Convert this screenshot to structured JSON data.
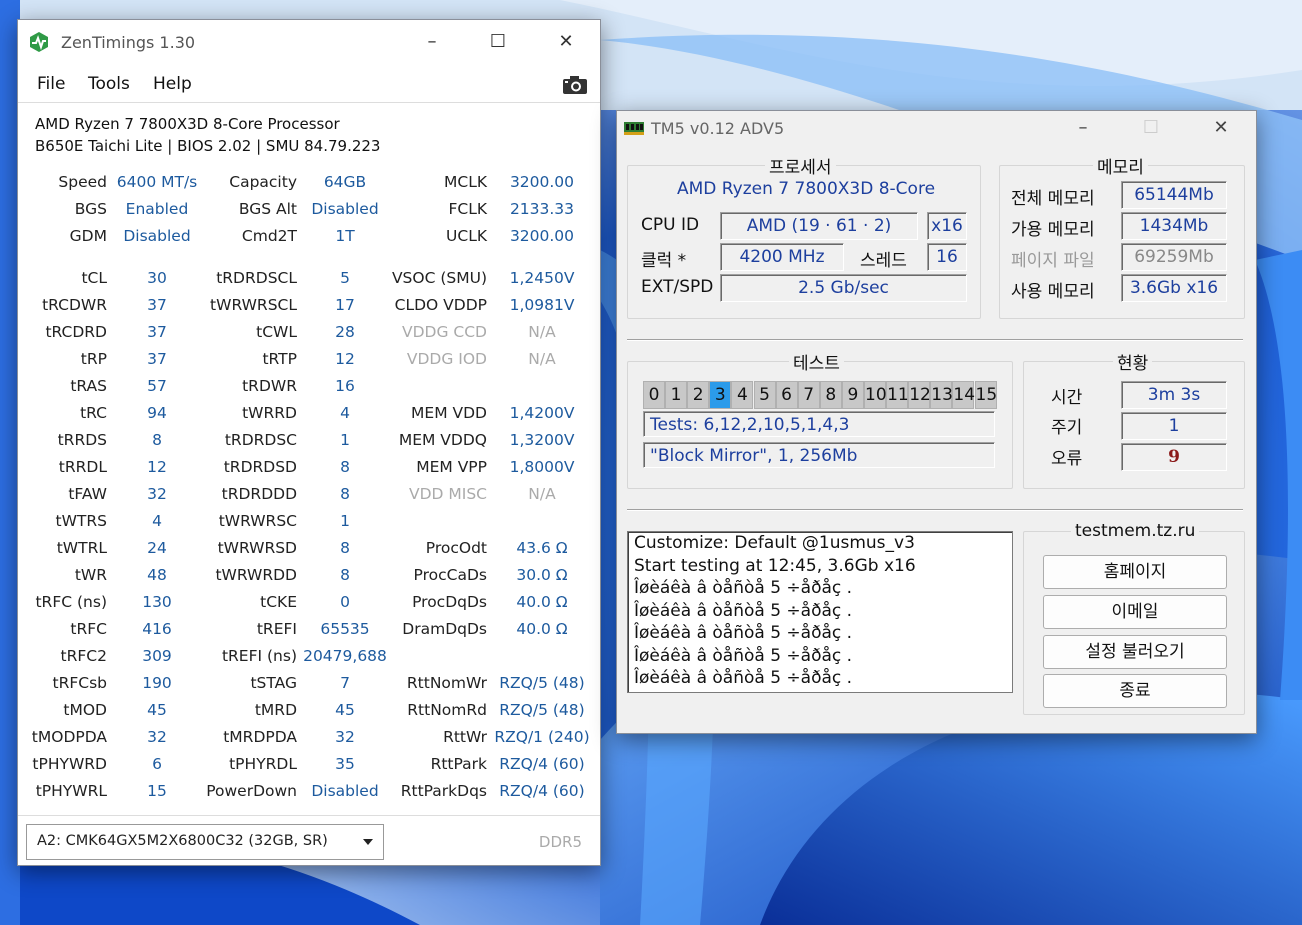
{
  "colors": {
    "value_blue": "#1d5a9e",
    "tm_blue": "#1d3f9e",
    "active_cell": "#2b9bea",
    "wallpaper": "#1f5fd6"
  },
  "zen": {
    "title": "ZenTimings 1.30",
    "menu": [
      "File",
      "Tools",
      "Help"
    ],
    "cpu_name": "AMD Ryzen 7 7800X3D 8-Core Processor",
    "board": "B650E Taichi Lite | BIOS 2.02 | SMU 84.79.223",
    "rows": [
      [
        "Speed",
        "6400 MT/s",
        "Capacity",
        "64GB",
        "MCLK",
        "3200.00"
      ],
      [
        "BGS",
        "Enabled",
        "BGS Alt",
        "Disabled",
        "FCLK",
        "2133.33"
      ],
      [
        "GDM",
        "Disabled",
        "Cmd2T",
        "1T",
        "UCLK",
        "3200.00"
      ],
      [
        "tCL",
        "30",
        "tRDRDSCL",
        "5",
        "VSOC (SMU)",
        "1,2450V"
      ],
      [
        "tRCDWR",
        "37",
        "tWRWRSCL",
        "17",
        "CLDO VDDP",
        "1,0981V"
      ],
      [
        "tRCDRD",
        "37",
        "tCWL",
        "28",
        "VDDG CCD",
        "N/A"
      ],
      [
        "tRP",
        "37",
        "tRTP",
        "12",
        "VDDG IOD",
        "N/A"
      ],
      [
        "tRAS",
        "57",
        "tRDWR",
        "16",
        "",
        ""
      ],
      [
        "tRC",
        "94",
        "tWRRD",
        "4",
        "MEM VDD",
        "1,4200V"
      ],
      [
        "tRRDS",
        "8",
        "tRDRDSC",
        "1",
        "MEM VDDQ",
        "1,3200V"
      ],
      [
        "tRRDL",
        "12",
        "tRDRDSD",
        "8",
        "MEM VPP",
        "1,8000V"
      ],
      [
        "tFAW",
        "32",
        "tRDRDDD",
        "8",
        "VDD MISC",
        "N/A"
      ],
      [
        "tWTRS",
        "4",
        "tWRWRSC",
        "1",
        "",
        ""
      ],
      [
        "tWTRL",
        "24",
        "tWRWRSD",
        "8",
        "ProcOdt",
        "43.6 Ω"
      ],
      [
        "tWR",
        "48",
        "tWRWRDD",
        "8",
        "ProcCaDs",
        "30.0 Ω"
      ],
      [
        "tRFC (ns)",
        "130",
        "tCKE",
        "0",
        "ProcDqDs",
        "40.0 Ω"
      ],
      [
        "tRFC",
        "416",
        "tREFI",
        "65535",
        "DramDqDs",
        "40.0 Ω"
      ],
      [
        "tRFC2",
        "309",
        "tREFI (ns)",
        "20479,688",
        "",
        ""
      ],
      [
        "tRFCsb",
        "190",
        "tSTAG",
        "7",
        "RttNomWr",
        "RZQ/5 (48)"
      ],
      [
        "tMOD",
        "45",
        "tMRD",
        "45",
        "RttNomRd",
        "RZQ/5 (48)"
      ],
      [
        "tMODPDA",
        "32",
        "tMRDPDA",
        "32",
        "RttWr",
        "RZQ/1 (240)"
      ],
      [
        "tPHYWRD",
        "6",
        "tPHYRDL",
        "35",
        "RttPark",
        "RZQ/4 (60)"
      ],
      [
        "tPHYWRL",
        "15",
        "PowerDown",
        "Disabled",
        "RttParkDqs",
        "RZQ/4 (60)"
      ]
    ],
    "module_select": "A2: CMK64GX5M2X6800C32 (32GB, SR)",
    "mem_type": "DDR5"
  },
  "tm5": {
    "title": "TM5 v0.12 ADV5",
    "processor": {
      "group_title": "프로세서",
      "cpu_name": "AMD Ryzen 7 7800X3D 8-Core",
      "cpuid_label": "CPU ID",
      "cpuid_value": "AMD  (19 · 61 · 2)",
      "cpuid_threads": "x16",
      "clock_label": "클럭 *",
      "clock_value": "4200 MHz",
      "thread_label": "스레드",
      "thread_value": "16",
      "ext_label": "EXT/SPD",
      "ext_value": "2.5 Gb/sec"
    },
    "memory": {
      "group_title": "메모리",
      "rows": [
        [
          "전체 메모리",
          "65144Mb"
        ],
        [
          "가용 메모리",
          "1434Mb"
        ],
        [
          "페이지 파일",
          "69259Mb"
        ],
        [
          "사용 메모리",
          "3.6Gb x16"
        ]
      ]
    },
    "test": {
      "group_title": "테스트",
      "cells": [
        "0",
        "1",
        "2",
        "3",
        "4",
        "5",
        "6",
        "7",
        "8",
        "9",
        "10",
        "11",
        "12",
        "13",
        "14",
        "15"
      ],
      "active_index": 3,
      "tests_line": "Tests: 6,12,2,10,5,1,4,3",
      "current_line": "\"Block Mirror\", 1, 256Mb"
    },
    "status": {
      "group_title": "현황",
      "time_label": "시간",
      "time_value": "3m 3s",
      "cycle_label": "주기",
      "cycle_value": "1",
      "error_label": "오류",
      "error_value": "9"
    },
    "log": [
      "Customize: Default @1usmus_v3",
      "Start testing at 12:45, 3.6Gb x16",
      "Îøèáêà â òåñòå 5 ÷åðåç .",
      "Îøèáêà â òåñòå 5 ÷åðåç .",
      "Îøèáêà â òåñòå 5 ÷åðåç .",
      "Îøèáêà â òåñòå 5 ÷åðåç .",
      "Îøèáêà â òåñòå 5 ÷åðåç ."
    ],
    "site": {
      "group_title": "testmem.tz.ru",
      "buttons": [
        "홈페이지",
        "이메일",
        "설정 불러오기",
        "종료"
      ]
    }
  }
}
